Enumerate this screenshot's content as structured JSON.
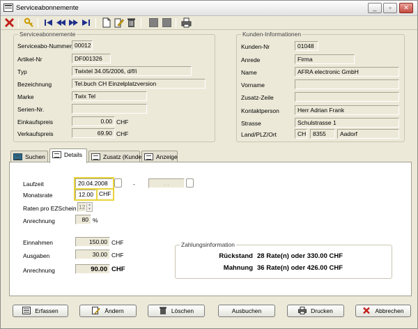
{
  "window": {
    "title": "Serviceabonnemente"
  },
  "icons": {
    "app": "form-icon",
    "minimize": "minimize-icon",
    "maximize": "maximize-icon",
    "close": "close-icon",
    "toolbar": [
      "close-red-x-icon",
      "key-icon",
      "first-record-icon",
      "previous-page-icon",
      "next-page-icon",
      "last-record-icon",
      "new-document-icon",
      "edit-document-icon",
      "delete-icon",
      "disabled-icon",
      "disabled-icon",
      "print-icon"
    ]
  },
  "colors": {
    "highlight": "#e8d43a",
    "close_red": "#c0392b",
    "window_bg": "#ece9d8"
  },
  "service": {
    "group_title": "Serviceabonnemente",
    "fields": [
      {
        "label": "Serviceabo-Nummer",
        "value": "00012"
      },
      {
        "label": "Artikel-Nr",
        "value": "DF001326"
      },
      {
        "label": "Typ",
        "value": "Twixtel 34.05/2006, d/f/i"
      },
      {
        "label": "Bezeichnung",
        "value": "Tel.buch CH Einzelplatzversion"
      },
      {
        "label": "Marke",
        "value": "Twix Tel"
      },
      {
        "label": "Serien-Nr.",
        "value": ""
      },
      {
        "label": "Einkaufspreis",
        "value": "0.00",
        "unit": "CHF"
      },
      {
        "label": "Verkaufspreis",
        "value": "69.90",
        "unit": "CHF"
      }
    ]
  },
  "customer": {
    "group_title": "Kunden-Informationen",
    "fields": [
      {
        "label": "Kunden-Nr",
        "value": "01048"
      },
      {
        "label": "Anrede",
        "value": "Firma"
      },
      {
        "label": "Name",
        "value": "AFRA electronic GmbH"
      },
      {
        "label": "Vorname",
        "value": ""
      },
      {
        "label": "Zusatz-Zeile",
        "value": ""
      },
      {
        "label": "Kontaktperson",
        "value": "Herr Adrian Frank"
      },
      {
        "label": "Strasse",
        "value": "Schulstrasse 1"
      },
      {
        "label": "Land/PLZ/Ort",
        "land": "CH",
        "plz": "8355",
        "ort": "Aadorf"
      }
    ]
  },
  "tabs": [
    {
      "label": "Suchen",
      "icon": "search-grid-icon",
      "active": false
    },
    {
      "label": "Details",
      "icon": "details-icon",
      "active": true
    },
    {
      "label": "Zusatz (Kunde)",
      "icon": "details-icon",
      "active": false
    },
    {
      "label": "Anzeige",
      "icon": "details-icon",
      "active": false
    }
  ],
  "details": {
    "laufzeit_label": "Laufzeit",
    "laufzeit_from": "20.04.2008",
    "laufzeit_sep": "-",
    "laufzeit_to": ". .",
    "monatsrate_label": "Monatsrate",
    "monatsrate_value": "12.00",
    "currency": "CHF",
    "raten_label": "Raten pro EZSchein",
    "raten_value": "12",
    "anrechnung_pct_label": "Anrechnung",
    "anrechnung_pct_value": "80",
    "pct_unit": "%",
    "einnahmen_label": "Einnahmen",
    "einnahmen_value": "150.00",
    "ausgaben_label": "Ausgaben",
    "ausgaben_value": "30.00",
    "anrechnung_label": "Anrechnung",
    "anrechnung_value": "90.00"
  },
  "zahlung": {
    "group_title": "Zahlungsinformation",
    "rueckstand_label": "Rückstand",
    "rueckstand_text": "28 Rate(n) oder   330.00 CHF",
    "mahnung_label": "Mahnung",
    "mahnung_text": "36 Rate(n) oder   426.00 CHF"
  },
  "buttons": {
    "erfassen": "Erfassen",
    "aendern": "Ändern",
    "loeschen": "Löschen",
    "ausbuchen": "Ausbuchen",
    "drucken": "Drucken",
    "abbrechen": "Abbrechen"
  }
}
